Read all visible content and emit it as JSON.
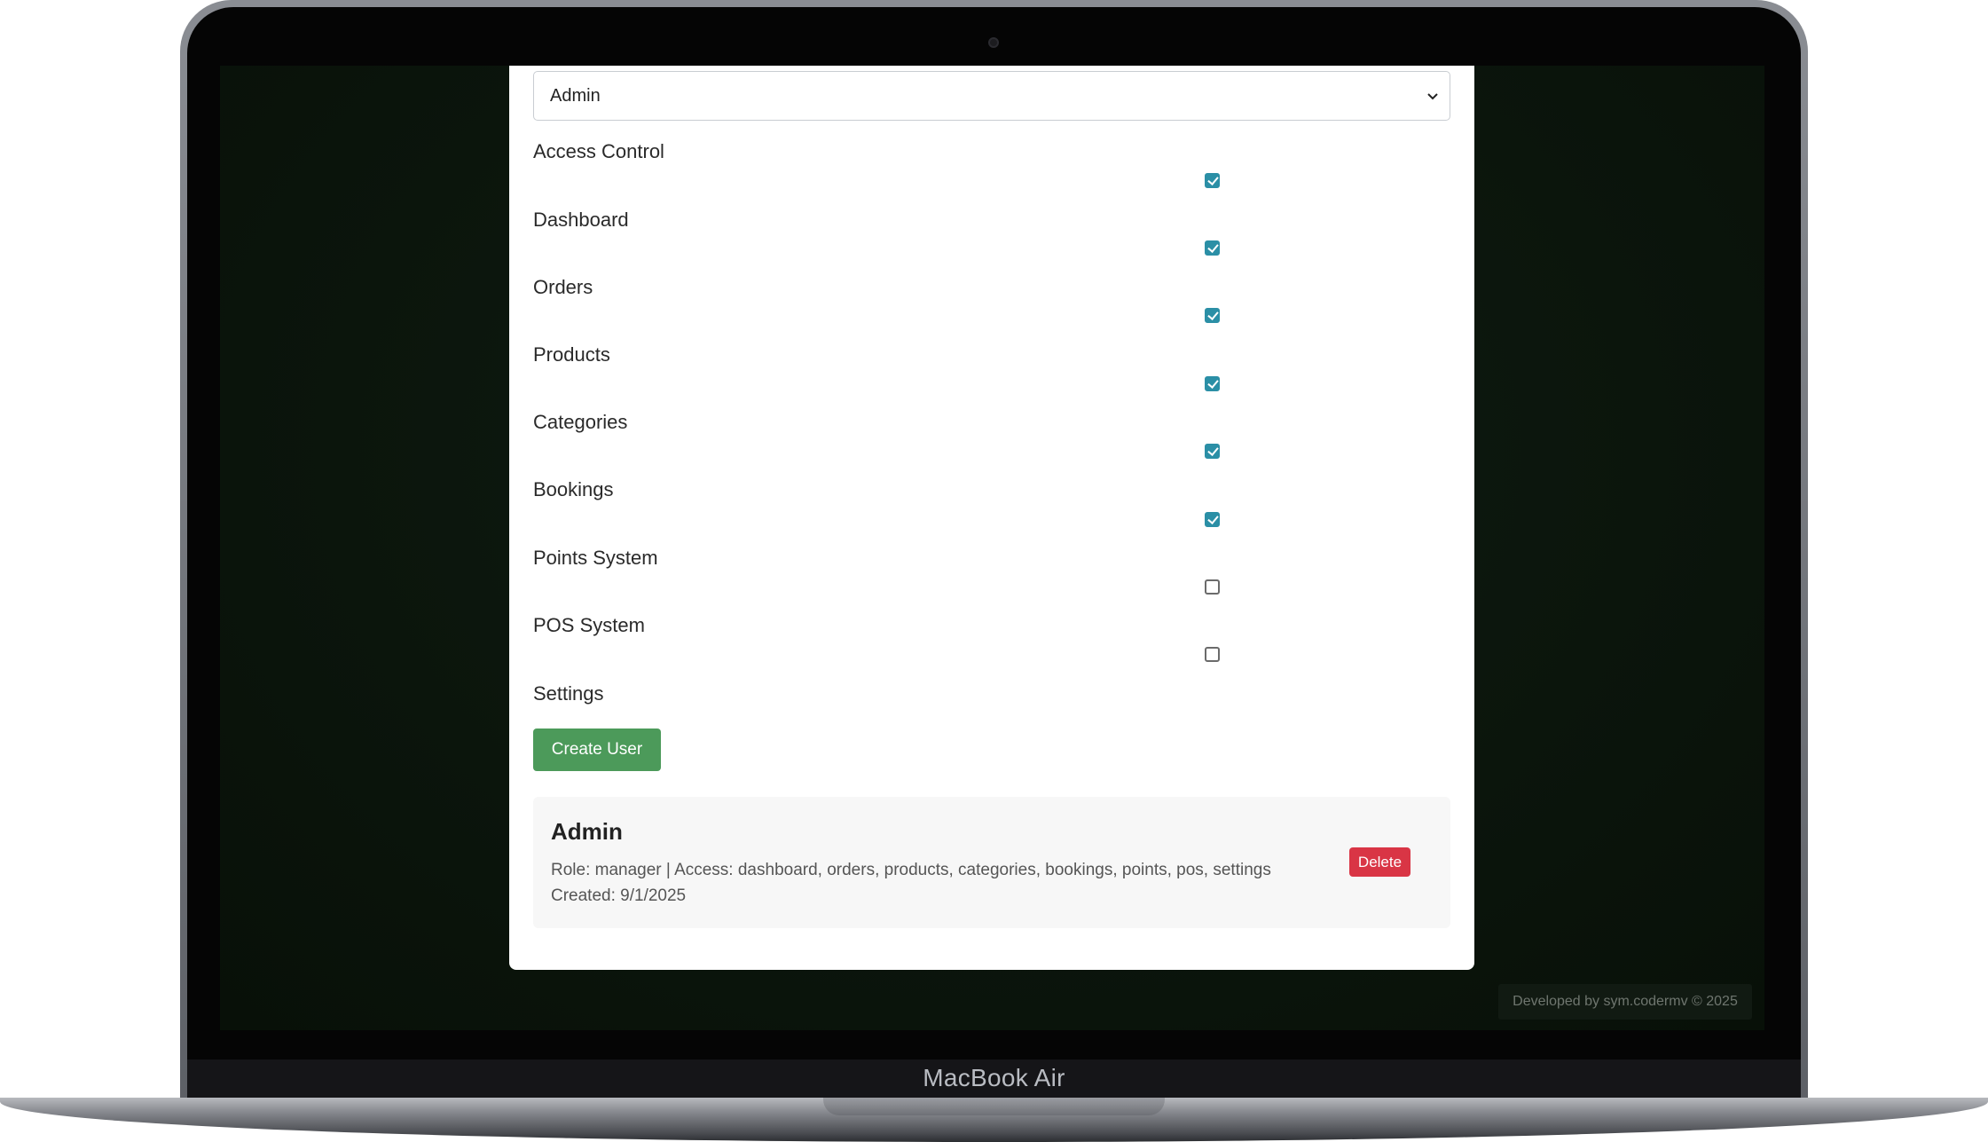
{
  "device": {
    "model_label": "MacBook Air"
  },
  "form": {
    "role_select": {
      "selected": "Admin"
    },
    "permissions": [
      {
        "label": "Access Control",
        "checked": true
      },
      {
        "label": "Dashboard",
        "checked": true
      },
      {
        "label": "Orders",
        "checked": true
      },
      {
        "label": "Products",
        "checked": true
      },
      {
        "label": "Categories",
        "checked": true
      },
      {
        "label": "Bookings",
        "checked": true
      },
      {
        "label": "Points System",
        "checked": false
      },
      {
        "label": "POS System",
        "checked": false
      },
      {
        "label": "Settings",
        "checked": null
      }
    ],
    "create_button": "Create User"
  },
  "users": [
    {
      "name": "Admin",
      "meta": "Role: manager | Access: dashboard, orders, products, categories, bookings, points, pos, settings",
      "created": "Created: 9/1/2025",
      "delete_label": "Delete"
    }
  ],
  "footer": {
    "credit": "Developed by sym.codermv © 2025"
  },
  "colors": {
    "checkbox_checked": "#2b8fa6",
    "create_button": "#4c9a5a",
    "delete_button": "#d93545",
    "background": "#0b150c"
  }
}
